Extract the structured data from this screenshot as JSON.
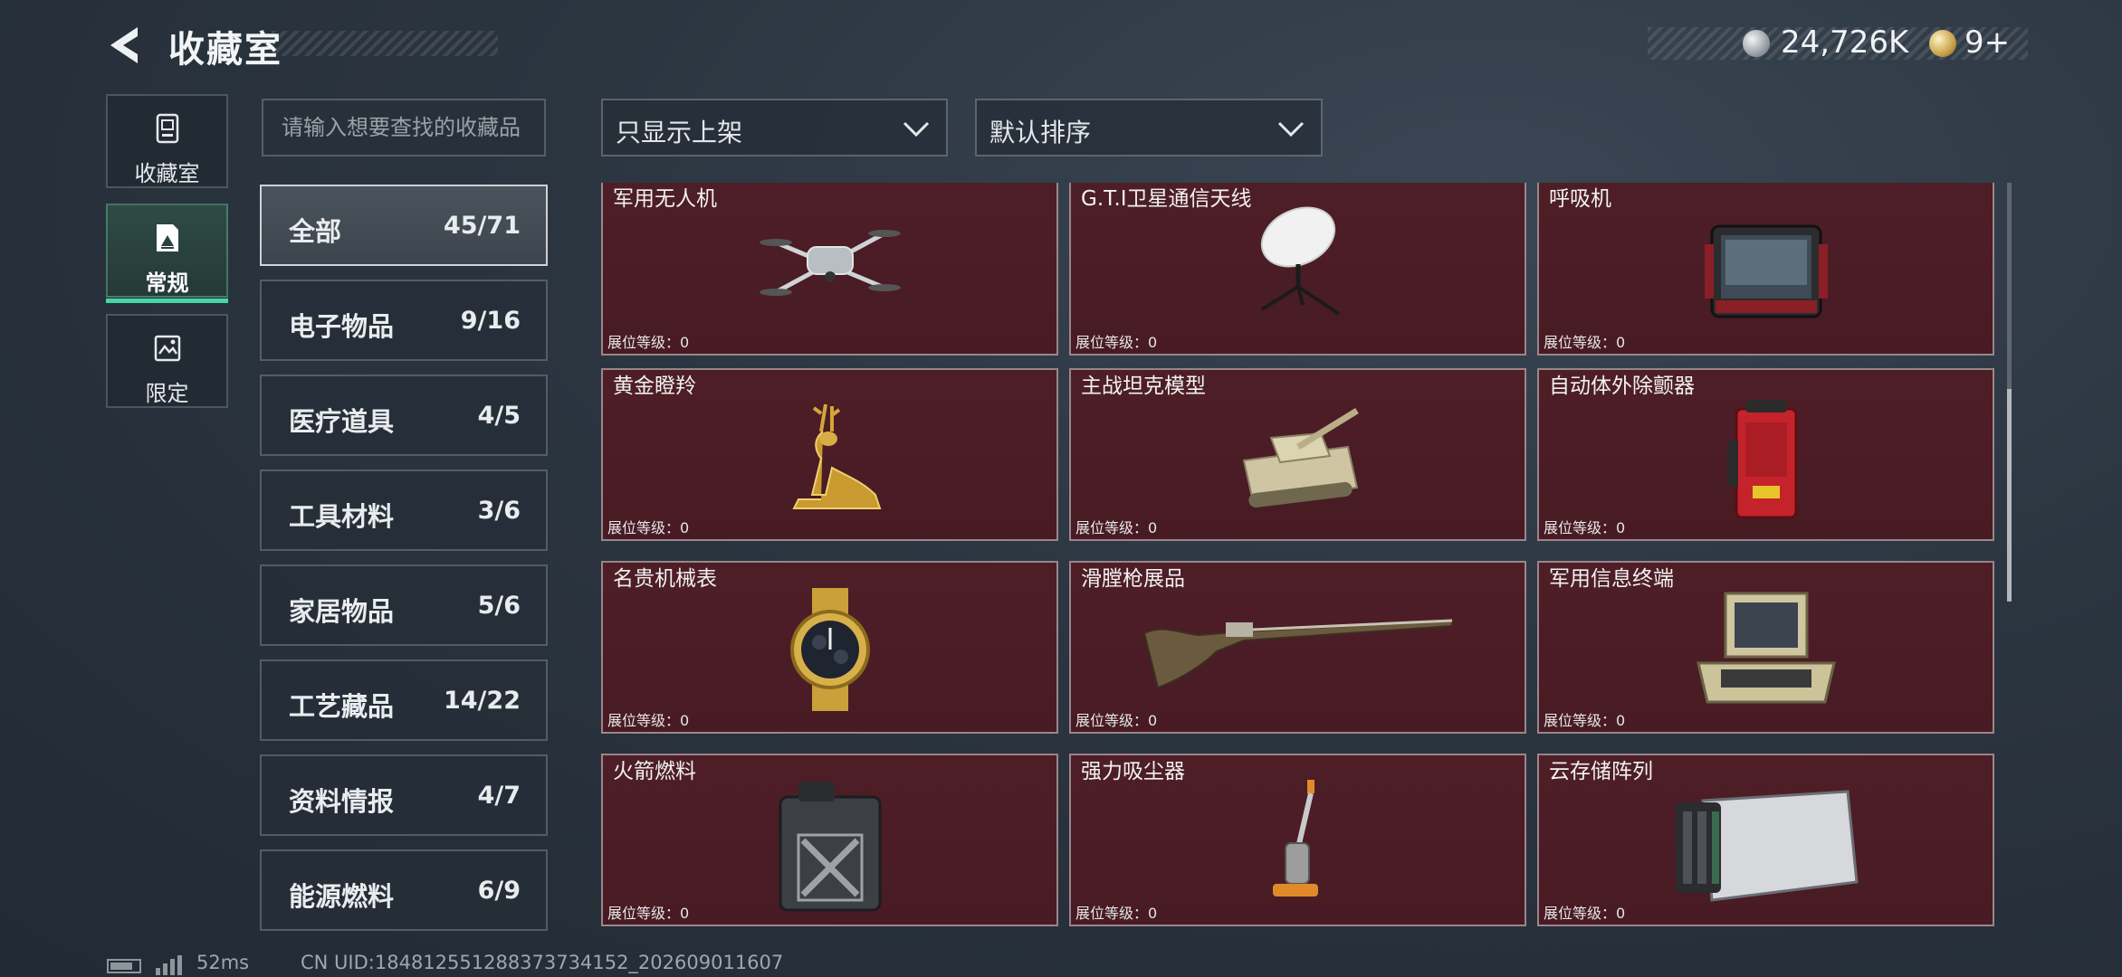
{
  "header": {
    "title": "收藏室",
    "currency_primary": "24,726K",
    "currency_secondary": "9+"
  },
  "side_tabs": [
    {
      "label": "收藏室",
      "icon": "vault-icon",
      "active": false
    },
    {
      "label": "常规",
      "icon": "regular-collection-icon",
      "active": true
    },
    {
      "label": "限定",
      "icon": "limited-collection-icon",
      "active": false
    }
  ],
  "search": {
    "placeholder": "请输入想要查找的收藏品"
  },
  "filters": {
    "display": "只显示上架",
    "sort": "默认排序"
  },
  "categories": [
    {
      "name": "全部",
      "count": "45/71"
    },
    {
      "name": "电子物品",
      "count": "9/16"
    },
    {
      "name": "医疗道具",
      "count": "4/5"
    },
    {
      "name": "工具材料",
      "count": "3/6"
    },
    {
      "name": "家居物品",
      "count": "5/6"
    },
    {
      "name": "工艺藏品",
      "count": "14/22"
    },
    {
      "name": "资料情报",
      "count": "4/7"
    },
    {
      "name": "能源燃料",
      "count": "6/9"
    }
  ],
  "items": [
    {
      "name": "军用无人机",
      "level": "展位等级：0",
      "art": "drone"
    },
    {
      "name": "G.T.I卫星通信天线",
      "level": "展位等级：0",
      "art": "satellite-dish"
    },
    {
      "name": "呼吸机",
      "level": "展位等级：0",
      "art": "ventilator"
    },
    {
      "name": "黄金瞪羚",
      "level": "展位等级：0",
      "art": "golden-gazelle"
    },
    {
      "name": "主战坦克模型",
      "level": "展位等级：0",
      "art": "tank-model"
    },
    {
      "name": "自动体外除颤器",
      "level": "展位等级：0",
      "art": "defibrillator"
    },
    {
      "name": "名贵机械表",
      "level": "展位等级：0",
      "art": "watch"
    },
    {
      "name": "滑膛枪展品",
      "level": "展位等级：0",
      "art": "musket"
    },
    {
      "name": "军用信息终端",
      "level": "展位等级：0",
      "art": "info-terminal"
    },
    {
      "name": "火箭燃料",
      "level": "展位等级：0",
      "art": "fuel-canister"
    },
    {
      "name": "强力吸尘器",
      "level": "展位等级：0",
      "art": "vacuum"
    },
    {
      "name": "云存储阵列",
      "level": "展位等级：0",
      "art": "storage-array"
    }
  ],
  "status_bar": {
    "ping": "52ms",
    "uid": "CN UID:1848125512883737341​52_202609011607"
  },
  "colors": {
    "accent": "#46d7a3",
    "card_bg": "#4e1e27",
    "background": "#2b3540"
  }
}
